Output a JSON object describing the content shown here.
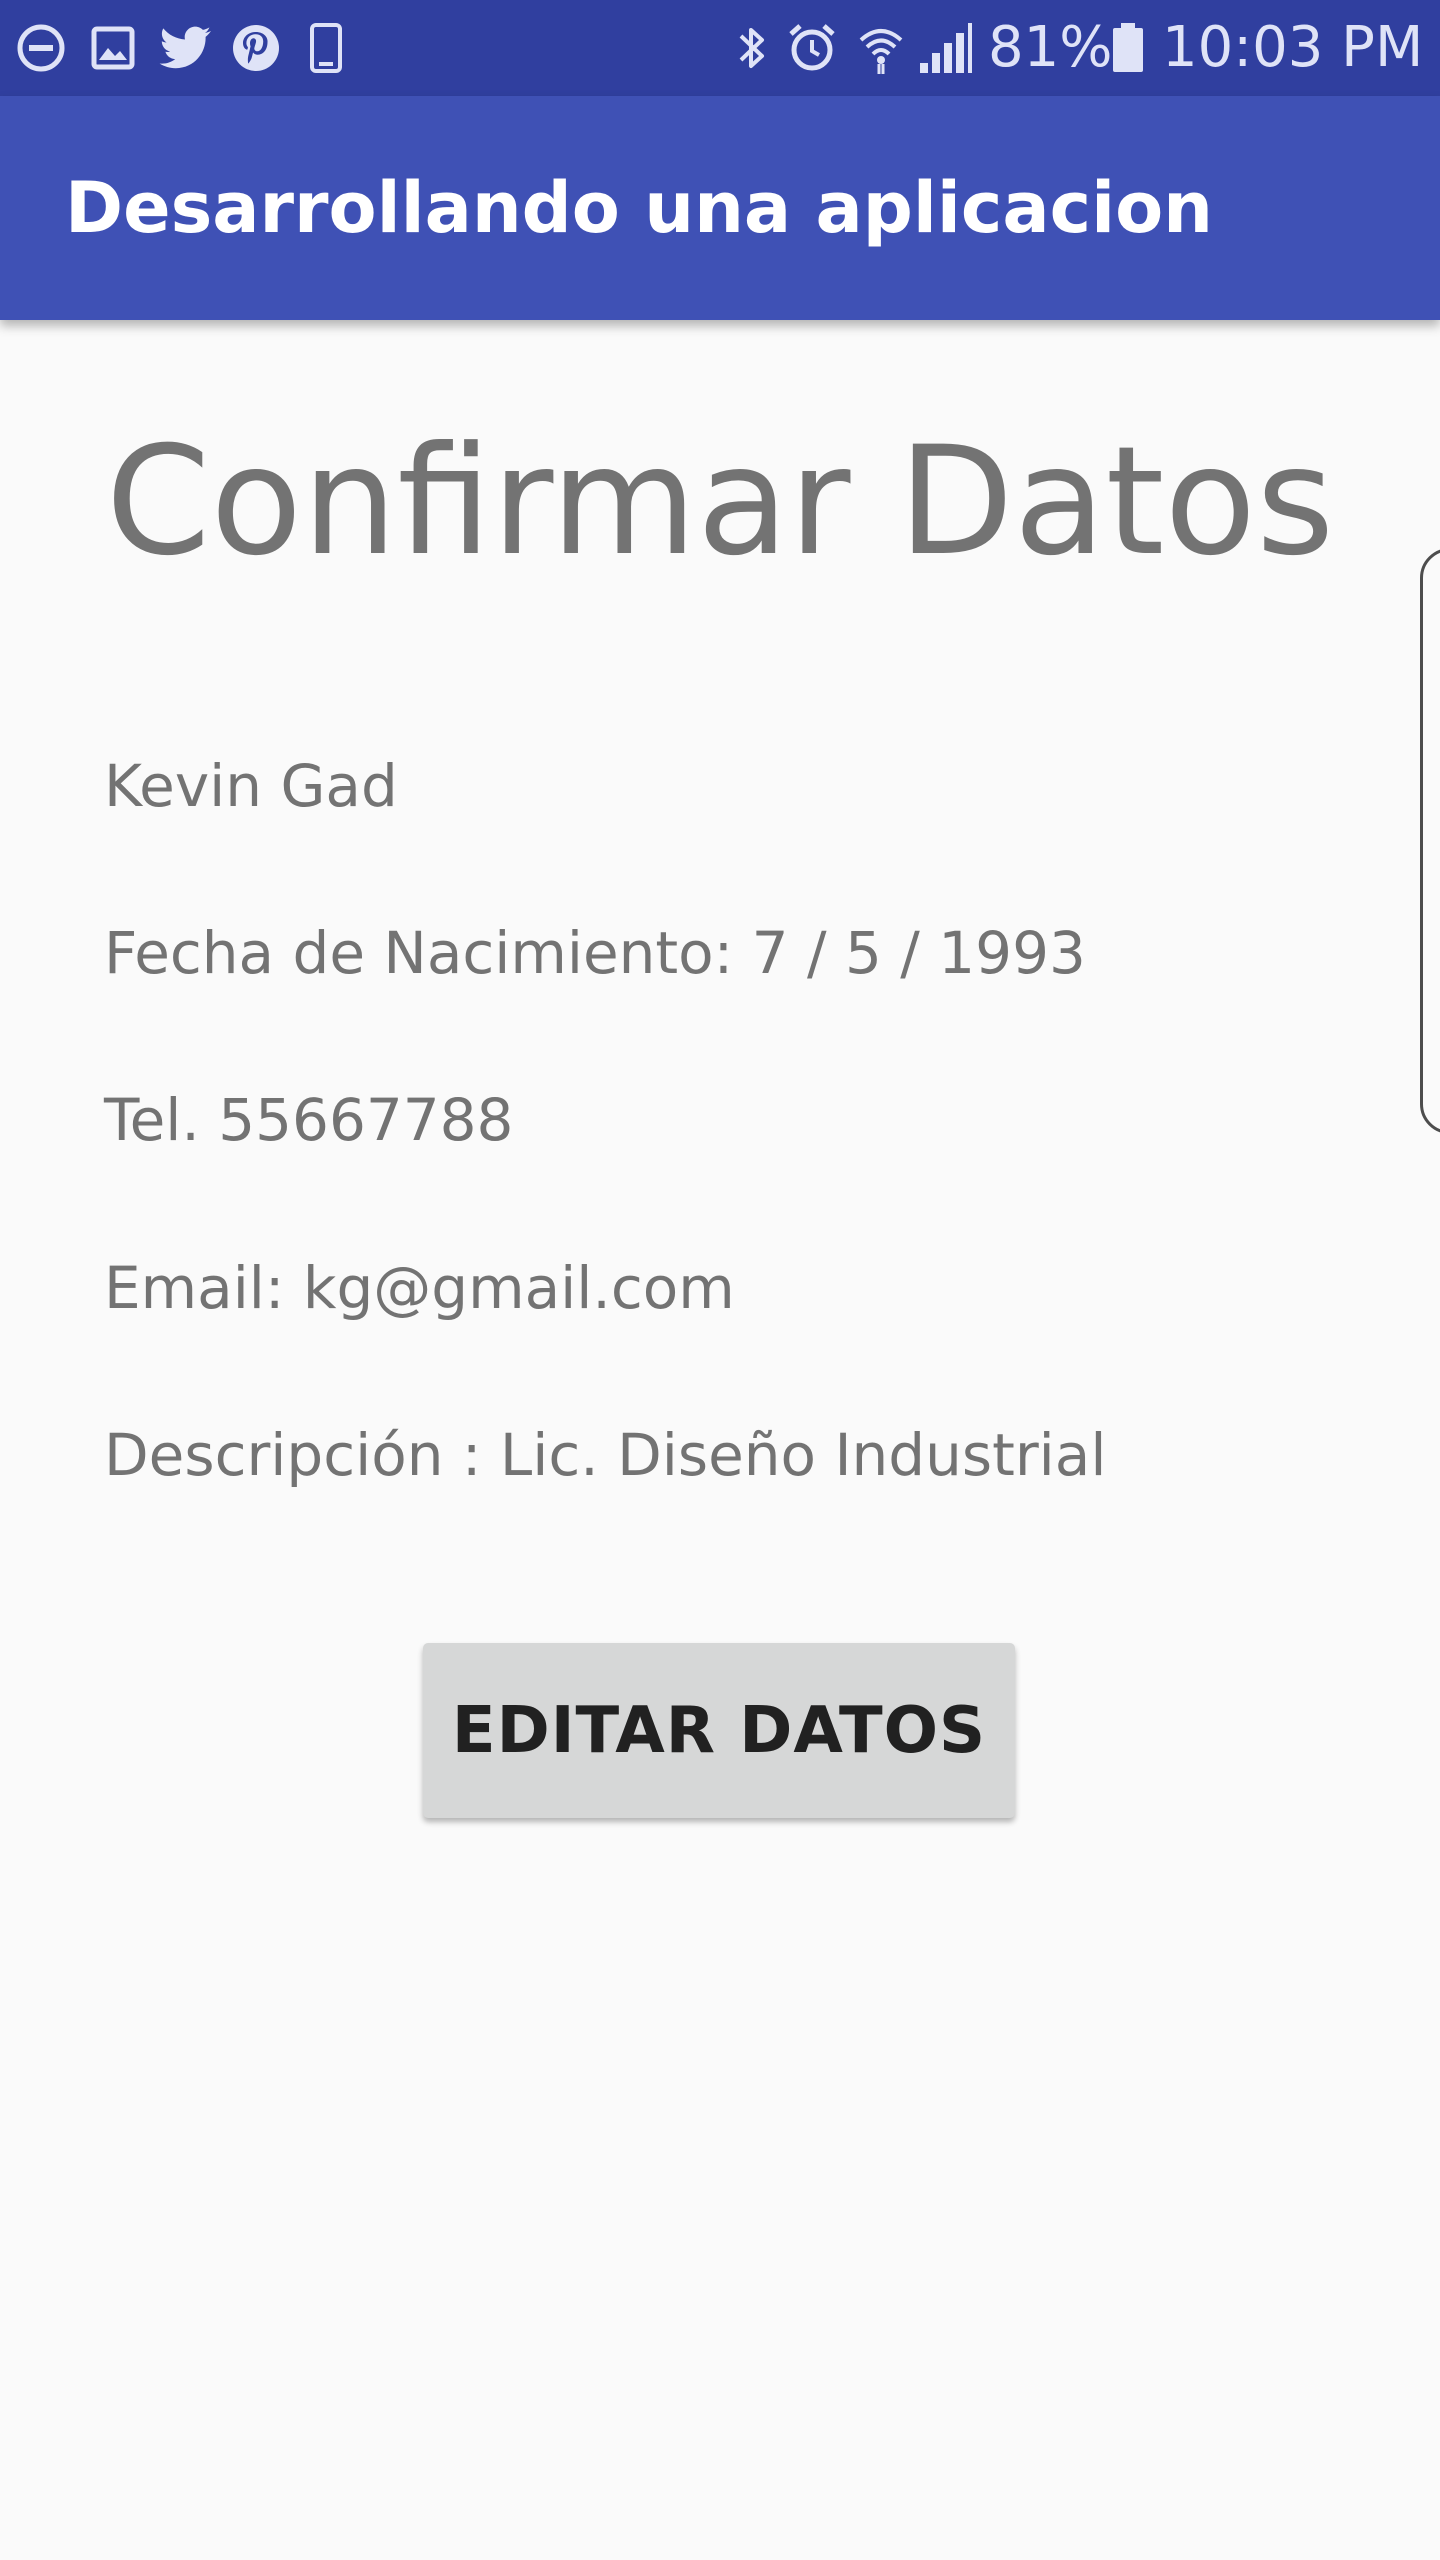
{
  "status_bar": {
    "battery_percent": "81%",
    "time": "10:03 PM",
    "icons": [
      "do-not-disturb-icon",
      "gallery-icon",
      "twitter-icon",
      "pinterest-icon",
      "phone-icon",
      "bluetooth-icon",
      "alarm-icon",
      "wifi-icon",
      "signal-icon",
      "battery-icon"
    ]
  },
  "app_bar": {
    "title": "Desarrollando una aplicacion"
  },
  "content": {
    "heading": "Confirmar Datos",
    "name": "Kevin Gad",
    "birth_date": "Fecha de Nacimiento: 7 / 5 / 1993",
    "phone": "Tel. 55667788",
    "email": "Email: kg@gmail.com",
    "description": "Descripción : Lic. Diseño Industrial"
  },
  "actions": {
    "edit_label": "EDITAR DATOS"
  },
  "colors": {
    "status_bar": "#303f9f",
    "app_bar": "#3f51b5",
    "background": "#fafafa",
    "text_secondary": "#737373",
    "button": "#d6d7d7"
  }
}
